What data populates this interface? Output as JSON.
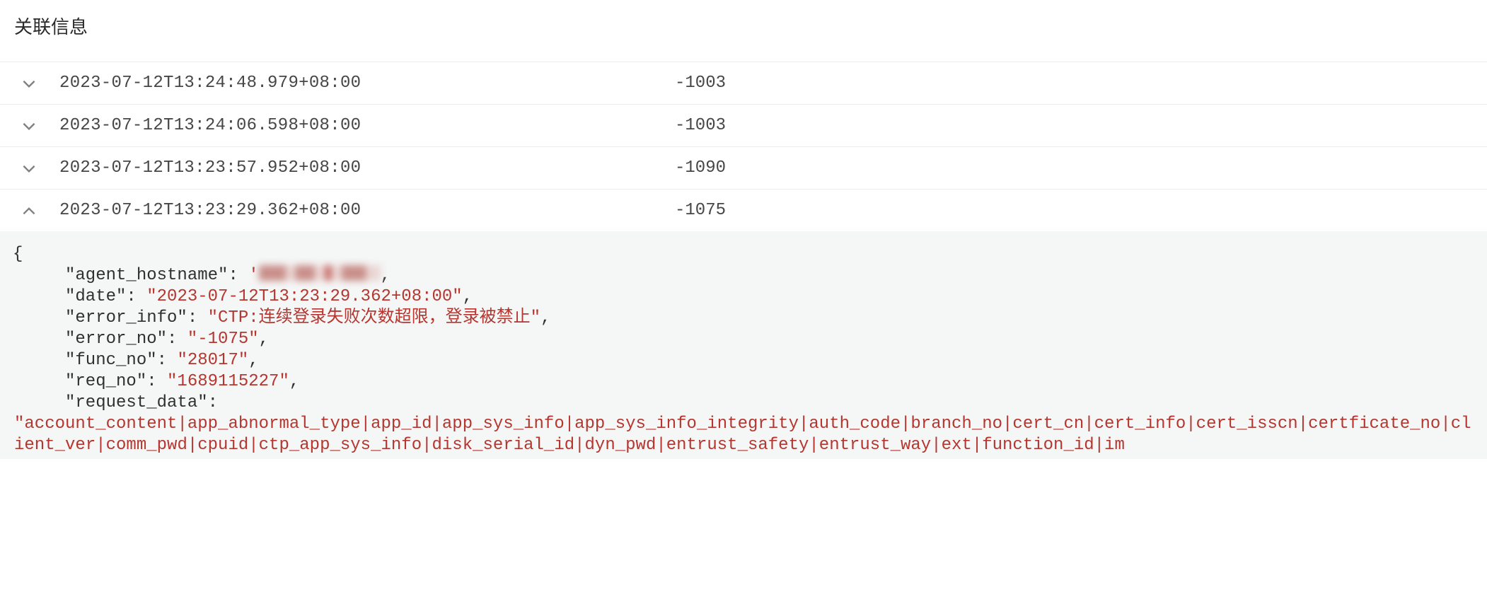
{
  "section_title": "关联信息",
  "rows": [
    {
      "expanded": false,
      "timestamp": "2023-07-12T13:24:48.979+08:00",
      "code": "-1003"
    },
    {
      "expanded": false,
      "timestamp": "2023-07-12T13:24:06.598+08:00",
      "code": "-1003"
    },
    {
      "expanded": false,
      "timestamp": "2023-07-12T13:23:57.952+08:00",
      "code": "-1090"
    },
    {
      "expanded": true,
      "timestamp": "2023-07-12T13:23:29.362+08:00",
      "code": "-1075"
    }
  ],
  "detail": {
    "open_brace": "{",
    "agent_hostname_key": "\"agent_hostname\"",
    "agent_hostname_value_redacted": true,
    "date_key": "\"date\"",
    "date_value": "\"2023-07-12T13:23:29.362+08:00\"",
    "error_info_key": "\"error_info\"",
    "error_info_value": "\"CTP:连续登录失败次数超限，登录被禁止\"",
    "error_no_key": "\"error_no\"",
    "error_no_value": "\"-1075\"",
    "func_no_key": "\"func_no\"",
    "func_no_value": "\"28017\"",
    "req_no_key": "\"req_no\"",
    "req_no_value": "\"1689115227\"",
    "request_data_key": "\"request_data\"",
    "request_data_value": "\"account_content|app_abnormal_type|app_id|app_sys_info|app_sys_info_integrity|auth_code|branch_no|cert_cn|cert_info|cert_isscn|certficate_no|client_ver|comm_pwd|cpuid|ctp_app_sys_info|disk_serial_id|dyn_pwd|entrust_safety|entrust_way|ext|function_id|im"
  },
  "punct": {
    "colon_space": ": ",
    "comma": ",",
    "colon": ":",
    "quote": "'"
  }
}
